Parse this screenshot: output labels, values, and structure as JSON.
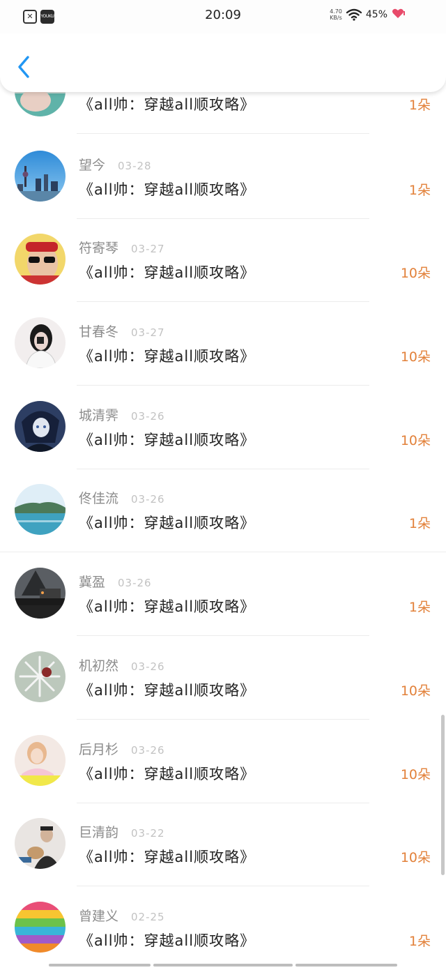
{
  "status_bar": {
    "time": "20:09",
    "net_speed_value": "4.70",
    "net_speed_unit": "KB/s",
    "battery": "45%",
    "notification_app_label": "YOUKU"
  },
  "header": {
    "back_icon": "chevron-left-icon"
  },
  "colors": {
    "accent_back": "#2196f3",
    "amount": "#e2813a"
  },
  "items": [
    {
      "name": "",
      "date": "",
      "title": "《all帅：穿越all顺攻略》",
      "amount": "1朵",
      "avatar": "teal-portrait"
    },
    {
      "name": "望今",
      "date": "03-28",
      "title": "《all帅：穿越all顺攻略》",
      "amount": "1朵",
      "avatar": "city-skyline"
    },
    {
      "name": "符寄琴",
      "date": "03-27",
      "title": "《all帅：穿越all顺攻略》",
      "amount": "10朵",
      "avatar": "man-red-cap"
    },
    {
      "name": "甘春冬",
      "date": "03-27",
      "title": "《all帅：穿越all顺攻略》",
      "amount": "10朵",
      "avatar": "girl-black-hair"
    },
    {
      "name": "城清霁",
      "date": "03-26",
      "title": "《all帅：穿越all顺攻略》",
      "amount": "10朵",
      "avatar": "anime-character"
    },
    {
      "name": "佟佳流",
      "date": "03-26",
      "title": "《all帅：穿越all顺攻略》",
      "amount": "1朵",
      "avatar": "island-sea"
    },
    {
      "name": "冀盈",
      "date": "03-26",
      "title": "《all帅：穿越all顺攻略》",
      "amount": "1朵",
      "avatar": "night-station"
    },
    {
      "name": "机初然",
      "date": "03-26",
      "title": "《all帅：穿越all顺攻略》",
      "amount": "10朵",
      "avatar": "snowflake"
    },
    {
      "name": "后月杉",
      "date": "03-26",
      "title": "《all帅：穿越all顺攻略》",
      "amount": "10朵",
      "avatar": "girl-pink"
    },
    {
      "name": "巨清韵",
      "date": "03-22",
      "title": "《all帅：穿越all顺攻略》",
      "amount": "10朵",
      "avatar": "man-with-dog"
    },
    {
      "name": "曾建义",
      "date": "02-25",
      "title": "《all帅：穿越all顺攻略》",
      "amount": "1朵",
      "avatar": "colorful-mustaches"
    }
  ]
}
